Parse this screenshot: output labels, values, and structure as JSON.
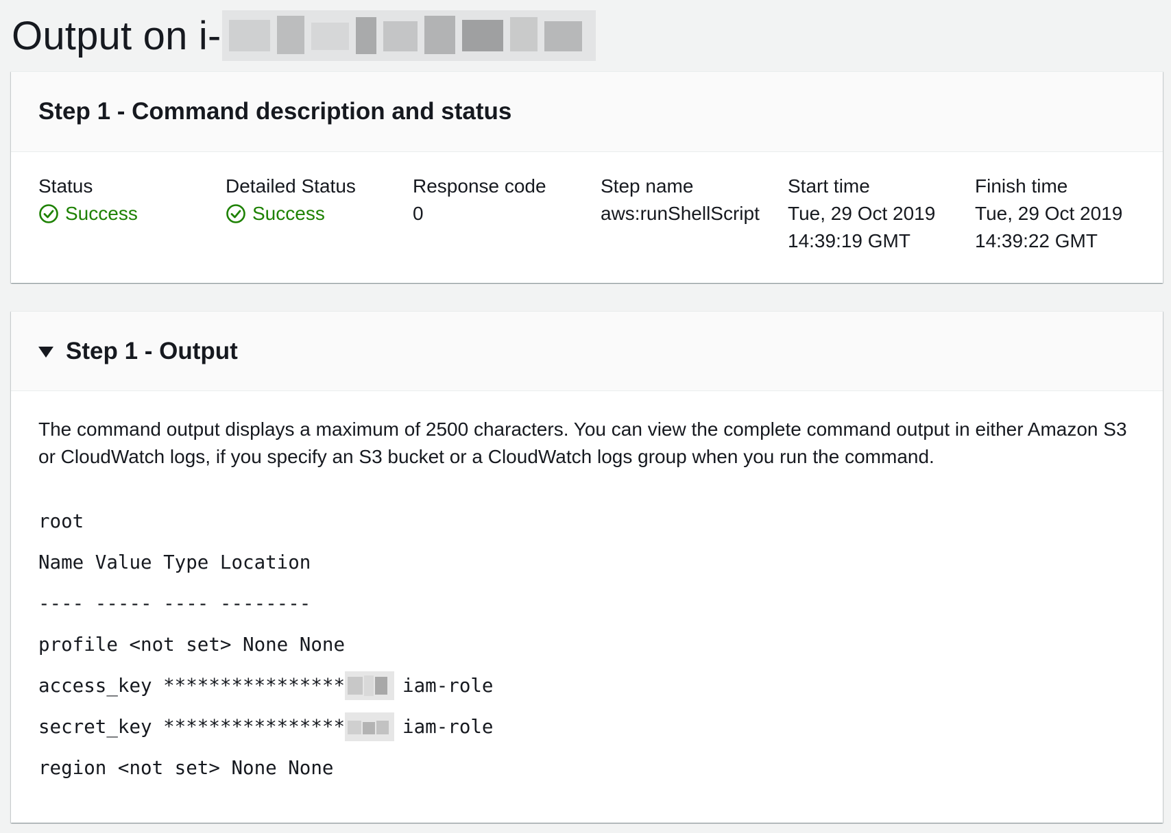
{
  "page": {
    "title": "Output on i-"
  },
  "status_panel": {
    "title": "Step 1 - Command description and status",
    "columns": [
      {
        "label": "Status",
        "value": "Success",
        "type": "success"
      },
      {
        "label": "Detailed Status",
        "value": "Success",
        "type": "success"
      },
      {
        "label": "Response code",
        "value": "0",
        "type": "text"
      },
      {
        "label": "Step name",
        "value": "aws:runShellScript",
        "type": "text"
      },
      {
        "label": "Start time",
        "value": "Tue, 29 Oct 2019 14:39:19 GMT",
        "type": "text"
      },
      {
        "label": "Finish time",
        "value": "Tue, 29 Oct 2019 14:39:22 GMT",
        "type": "text"
      }
    ],
    "success_icon": "check-circle-icon",
    "success_color": "#1d8102"
  },
  "output_panel": {
    "title": "Step 1 - Output",
    "expanded": true,
    "caret_icon": "caret-down-icon",
    "note": "The command output displays a maximum of 2500 characters. You can view the complete command output in either Amazon S3 or CloudWatch logs, if you specify an S3 bucket or a CloudWatch logs group when you run the command.",
    "lines": [
      {
        "text": "root"
      },
      {
        "text": "Name Value Type Location"
      },
      {
        "text": "---- ----- ---- --------"
      },
      {
        "text": "profile <not set> None None"
      },
      {
        "text": "access_key ****************",
        "suffix": "iam-role",
        "redacted": true
      },
      {
        "text": "secret_key ****************",
        "suffix": "iam-role",
        "redacted": true
      },
      {
        "text": "region <not set> None None"
      }
    ]
  }
}
